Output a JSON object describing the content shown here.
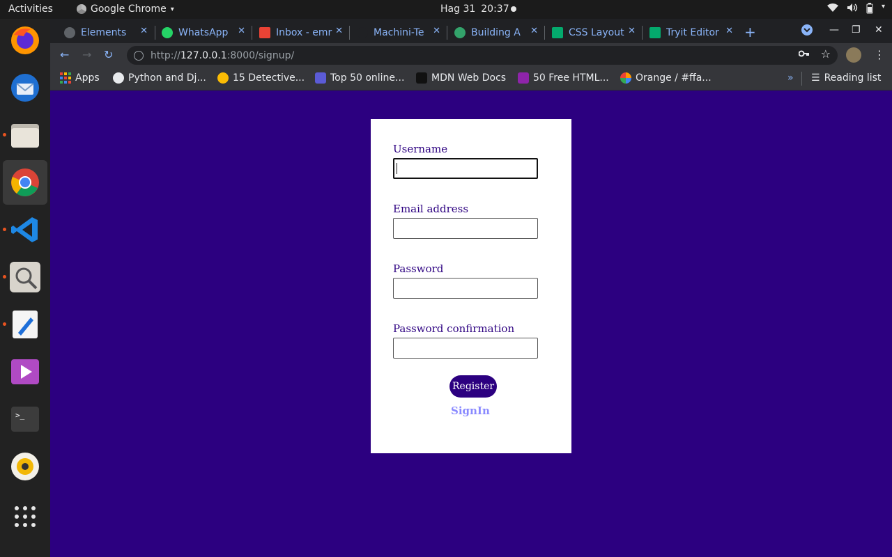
{
  "topbar": {
    "activities": "Activities",
    "app_name": "Google Chrome",
    "date": "Hag 31",
    "time": "20:37"
  },
  "dock": {
    "items": [
      "firefox-icon",
      "thunderbird-icon",
      "files-icon",
      "chrome-icon",
      "vscode-icon",
      "magnifier-icon",
      "text-editor-icon",
      "media-player-icon",
      "terminal-icon",
      "rhythmbox-icon",
      "app-grid-icon"
    ]
  },
  "tabs": [
    {
      "title": "Elements",
      "favicon": "globe-icon",
      "color": "#5f6368"
    },
    {
      "title": "WhatsApp",
      "favicon": "whatsapp-icon",
      "color": "#25d366"
    },
    {
      "title": "Inbox - emr",
      "favicon": "gmail-icon",
      "color": "#ea4335"
    },
    {
      "title": "Machini-Te",
      "favicon": "github-icon",
      "color": "#202124"
    },
    {
      "title": "Building A",
      "favicon": "python-icon",
      "color": "#33a36b"
    },
    {
      "title": "CSS Layout",
      "favicon": "w3schools-icon",
      "color": "#04aa6d"
    },
    {
      "title": "Tryit Editor",
      "favicon": "w3schools-icon",
      "color": "#04aa6d"
    }
  ],
  "address": {
    "scheme": "http://",
    "host": "127.0.0.1",
    "rest": ":8000/signup/"
  },
  "bookmarks": [
    {
      "label": "Apps",
      "color": "#ea4335"
    },
    {
      "label": "Python and Dj...",
      "color": "#e8eaed"
    },
    {
      "label": "15 Detective...",
      "color": "#fbbc04"
    },
    {
      "label": "Top 50 online...",
      "color": "#5b5bd6"
    },
    {
      "label": "MDN Web Docs",
      "color": "#111111"
    },
    {
      "label": "50 Free HTML...",
      "color": "#8e24aa"
    },
    {
      "label": "Orange / #ffa...",
      "color": "#ff9800"
    }
  ],
  "reading_list": "Reading list",
  "form": {
    "username_label": "Username",
    "email_label": "Email address",
    "password_label": "Password",
    "password_confirm_label": "Password confirmation",
    "register_label": "Register",
    "signin_label": "SignIn"
  },
  "colors": {
    "page_bg": "#2c0080",
    "card_bg": "#ffffff",
    "button_bg": "#2c0080",
    "link": "#8a8aff"
  }
}
